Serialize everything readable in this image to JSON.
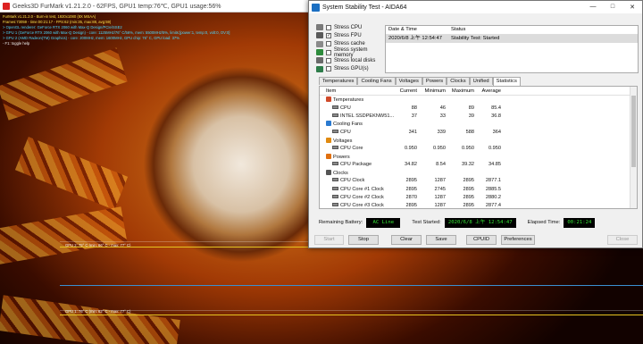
{
  "furmark": {
    "title": "Geeks3D FurMark v1.21.2.0 - 62FPS, GPU1 temp:76℃, GPU1 usage:56%",
    "osd_lines": [
      {
        "text": "FurMark v1.21.2.0 - Burn-in test, 1920x1080 (8X MSAA)",
        "color": "yellow"
      },
      {
        "text": "Frames:73059 - time:00:21:17 - FPS:62 (min:35, max:88, avg:59)",
        "color": "yellow"
      },
      {
        "text": "> OpenGL renderer: GeForce RTX 2060 with Max-Q Design/PCIe/SSE2",
        "color": "cyan"
      },
      {
        "text": "> GPU 1 (GeForce RTX 2060 with Max-Q Design) - core: 1125MHz/76° C/56%, mem: 5500MHz/5%, limits:[power:1, temp:0, volt:0, OV:0]",
        "color": "cyan"
      },
      {
        "text": "> GPU 2 (AMD Radeon(TM) Graphics) - core: 200MHz, mem: 1600MHz, GPU chip: 76° C, GPU load: 37%",
        "color": "cyan"
      },
      {
        "text": "- F1: toggle help",
        "color": "white"
      }
    ],
    "graph1_label": "GPU 2: 75° C (min: 66° C - max: 77° C)",
    "graph2_label": "GPU 1: 76° C (min: 62° C - max: 77° C)"
  },
  "aida": {
    "title": "System Stability Test - AIDA64",
    "window_controls": [
      "—",
      "□",
      "✕"
    ],
    "stress_options": [
      {
        "label": "Stress CPU",
        "checked": false,
        "icon": "cpu-icon",
        "color": "#7a7a7a"
      },
      {
        "label": "Stress FPU",
        "checked": true,
        "icon": "fpu-icon",
        "color": "#5a5a5a"
      },
      {
        "label": "Stress cache",
        "checked": false,
        "icon": "cache-icon",
        "color": "#8a8a8a"
      },
      {
        "label": "Stress system memory",
        "checked": false,
        "icon": "memory-icon",
        "color": "#2e8b3c"
      },
      {
        "label": "Stress local disks",
        "checked": false,
        "icon": "disk-icon",
        "color": "#6a6a6a"
      },
      {
        "label": "Stress GPU(s)",
        "checked": false,
        "icon": "gpu-icon",
        "color": "#2e7d4a"
      }
    ],
    "status_table": {
      "header_date": "Date & Time",
      "header_status": "Status",
      "row_date": "2020/6/8 上午 12:54:47",
      "row_status": "Stability Test: Started"
    },
    "tabs": [
      "Temperatures",
      "Cooling Fans",
      "Voltages",
      "Powers",
      "Clocks",
      "Unified",
      "Statistics"
    ],
    "active_tab": "Statistics",
    "stats_headers": {
      "item": "Item",
      "current": "Current",
      "minimum": "Minimum",
      "maximum": "Maximum",
      "average": "Average"
    },
    "stats_rows": [
      {
        "type": "group",
        "label": "Temperatures",
        "icon": "thermometer-icon",
        "color": "#d04a2a"
      },
      {
        "type": "sub",
        "label": "CPU",
        "current": "88",
        "minimum": "46",
        "maximum": "89",
        "average": "85.4"
      },
      {
        "type": "sub",
        "label": "INTEL SSDPEKNW51...",
        "current": "37",
        "minimum": "33",
        "maximum": "39",
        "average": "36.8"
      },
      {
        "type": "group",
        "label": "Cooling Fans",
        "icon": "fan-icon",
        "color": "#2a7ad0"
      },
      {
        "type": "sub",
        "label": "CPU",
        "current": "341",
        "minimum": "339",
        "maximum": "588",
        "average": "364"
      },
      {
        "type": "group",
        "label": "Voltages",
        "icon": "voltage-icon",
        "color": "#e08a10"
      },
      {
        "type": "sub",
        "label": "CPU Core",
        "current": "0.950",
        "minimum": "0.950",
        "maximum": "0.950",
        "average": "0.950"
      },
      {
        "type": "group",
        "label": "Powers",
        "icon": "power-icon",
        "color": "#e07010"
      },
      {
        "type": "sub",
        "label": "CPU Package",
        "current": "34.82",
        "minimum": "8.54",
        "maximum": "39.32",
        "average": "34.85"
      },
      {
        "type": "group",
        "label": "Clocks",
        "icon": "clock-icon",
        "color": "#555555"
      },
      {
        "type": "sub",
        "label": "CPU Clock",
        "current": "2895",
        "minimum": "1287",
        "maximum": "2895",
        "average": "2877.1"
      },
      {
        "type": "sub",
        "label": "CPU Core #1 Clock",
        "current": "2895",
        "minimum": "2745",
        "maximum": "2895",
        "average": "2885.5"
      },
      {
        "type": "sub",
        "label": "CPU Core #2 Clock",
        "current": "2870",
        "minimum": "1287",
        "maximum": "2895",
        "average": "2880.2"
      },
      {
        "type": "sub",
        "label": "CPU Core #3 Clock",
        "current": "2895",
        "minimum": "1287",
        "maximum": "2895",
        "average": "2877.4"
      }
    ],
    "remaining_battery_label": "Remaining Battery:",
    "remaining_battery_value": "AC Line",
    "test_started_label": "Test Started:",
    "test_started_value": "2020/6/8 上午 12:54:47",
    "elapsed_label": "Elapsed Time:",
    "elapsed_value": "00:21:24",
    "buttons": {
      "start": "Start",
      "stop": "Stop",
      "clear": "Clear",
      "save": "Save",
      "cpuid": "CPUID",
      "preferences": "Preferences",
      "close": "Close"
    }
  }
}
